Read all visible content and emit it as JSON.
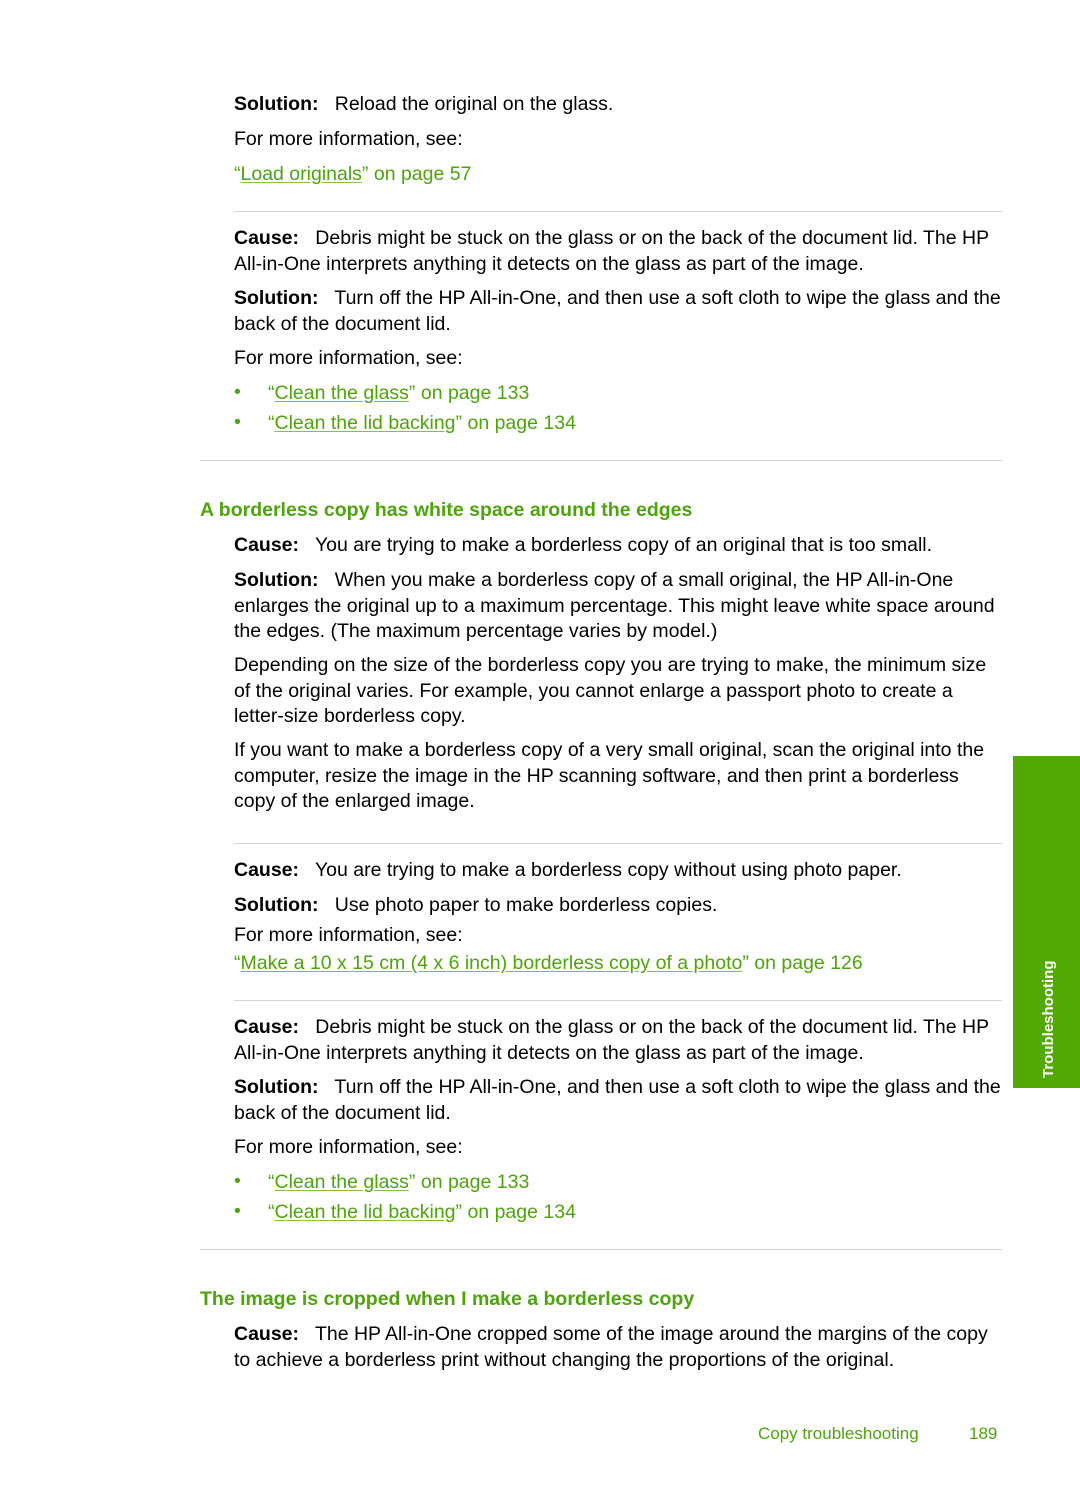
{
  "labels": {
    "cause": "Cause:",
    "solution": "Solution:",
    "for_more": "For more information, see:",
    "bullet": "•"
  },
  "block1": {
    "solution": "Reload the original on the glass.",
    "link": {
      "text": "Load originals",
      "page": "on page 57"
    }
  },
  "block2": {
    "cause": "Debris might be stuck on the glass or on the back of the document lid. The HP All-in-One interprets anything it detects on the glass as part of the image.",
    "solution": "Turn off the HP All-in-One, and then use a soft cloth to wipe the glass and the back of the document lid.",
    "links": [
      {
        "text": "Clean the glass",
        "page": "on page 133"
      },
      {
        "text": "Clean the lid backing",
        "page": "on page 134"
      }
    ]
  },
  "section1": {
    "title": "A borderless copy has white space around the edges",
    "cause": "You are trying to make a borderless copy of an original that is too small.",
    "solution": "When you make a borderless copy of a small original, the HP All-in-One enlarges the original up to a maximum percentage. This might leave white space around the edges. (The maximum percentage varies by model.)",
    "para1": "Depending on the size of the borderless copy you are trying to make, the minimum size of the original varies. For example, you cannot enlarge a passport photo to create a letter-size borderless copy.",
    "para2": "If you want to make a borderless copy of a very small original, scan the original into the computer, resize the image in the HP scanning software, and then print a borderless copy of the enlarged image."
  },
  "block3": {
    "cause": "You are trying to make a borderless copy without using photo paper.",
    "solution": "Use photo paper to make borderless copies.",
    "link": {
      "text": "Make a 10 x 15 cm (4 x 6 inch) borderless copy of a photo",
      "page": "on page 126"
    }
  },
  "block4": {
    "cause": "Debris might be stuck on the glass or on the back of the document lid. The HP All-in-One interprets anything it detects on the glass as part of the image.",
    "solution": "Turn off the HP All-in-One, and then use a soft cloth to wipe the glass and the back of the document lid.",
    "links": [
      {
        "text": "Clean the glass",
        "page": "on page 133"
      },
      {
        "text": "Clean the lid backing",
        "page": "on page 134"
      }
    ]
  },
  "section2": {
    "title": "The image is cropped when I make a borderless copy",
    "cause": "The HP All-in-One cropped some of the image around the margins of the copy to achieve a borderless print without changing the proportions of the original."
  },
  "side_tab": "Troubleshooting",
  "footer": {
    "section": "Copy troubleshooting",
    "page_number": "189"
  },
  "colors": {
    "accent": "#4ea40b",
    "tab": "#52a805",
    "rule": "#d4d4d4"
  }
}
